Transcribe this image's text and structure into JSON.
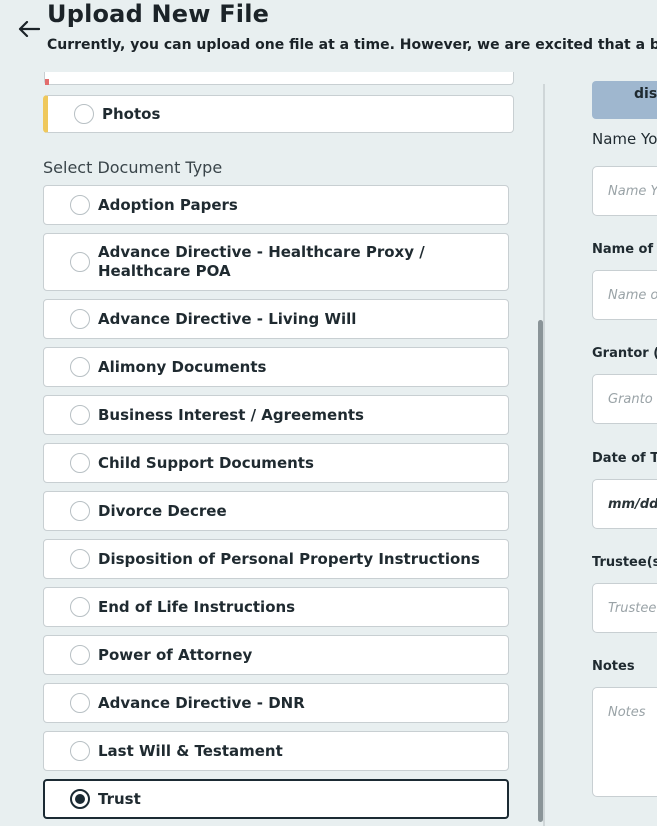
{
  "header": {
    "title": "Upload New File",
    "subtitle": "Currently, you can upload one file at a time. However, we are excited that a bul"
  },
  "photos_option": {
    "label": "Photos"
  },
  "doc_type": {
    "section_label": "Select Document Type",
    "options": [
      {
        "label": "Adoption Papers"
      },
      {
        "label": "Advance Directive - Healthcare Proxy / Healthcare POA"
      },
      {
        "label": "Advance Directive - Living Will"
      },
      {
        "label": "Alimony Documents"
      },
      {
        "label": "Business Interest / Agreements"
      },
      {
        "label": "Child Support Documents"
      },
      {
        "label": "Divorce Decree"
      },
      {
        "label": "Disposition of Personal Property Instructions"
      },
      {
        "label": "End of Life Instructions"
      },
      {
        "label": "Power of Attorney"
      },
      {
        "label": "Advance Directive - DNR"
      },
      {
        "label": "Last Will & Testament"
      },
      {
        "label": "Trust"
      }
    ],
    "selected": "Trust"
  },
  "right": {
    "drop_text": "dis",
    "name_label": "Name Yo",
    "name_placeholder": "Name Y",
    "name_of_label": "Name of A",
    "name_of_placeholder": "Name o",
    "grantor_label": "Grantor (T",
    "grantor_placeholder": "Granto",
    "date_label": "Date of Tr",
    "date_placeholder": "mm/dd/",
    "trustee_label": "Trustee(s)",
    "trustee_placeholder": "Trustee",
    "notes_label": "Notes",
    "notes_placeholder": "Notes"
  },
  "colors": {
    "background": "#e8eff0",
    "photos_accent": "#efc85c",
    "drop_box": "#9fb7cf",
    "selected": "#1b2a33"
  }
}
